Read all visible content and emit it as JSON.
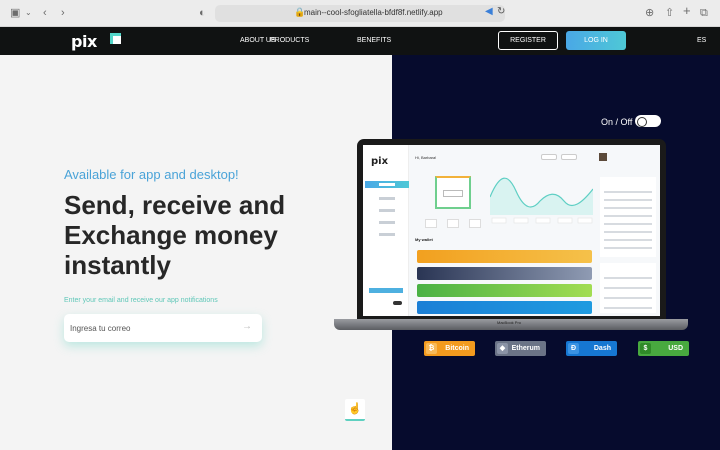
{
  "browser": {
    "url": "main--cool-sfogliatella-bfdf8f.netlify.app"
  },
  "nav": {
    "logo": "pix",
    "links": [
      {
        "label": "ABOUT US"
      },
      {
        "label": "PRODUCTS"
      },
      {
        "label": "BENEFITS"
      }
    ],
    "register_label": "REGISTER",
    "login_label": "LOG IN",
    "language": "ES"
  },
  "hero": {
    "tagline": "Available for app and desktop!",
    "headline": [
      "Send, receive and",
      "Exchange money",
      "instantly"
    ],
    "notify_text": "Enter your email and receive our app notifications",
    "email_placeholder": "Ingresa tu correo",
    "toggle_label": "On / Off"
  },
  "laptop": {
    "brand_label": "MacBook Pro",
    "dashboard_logo": "pix",
    "greeting": "Hi, Barbara!",
    "balance": "$ 12,830.54",
    "wallet_title": "My wallet",
    "panel_movements": "Últimos Movimientos",
    "panel_friends": "Amigos"
  },
  "currencies": [
    {
      "label": "Bitcoin",
      "color": "#f39b1e"
    },
    {
      "label": "Etherum",
      "color": "#6b7487"
    },
    {
      "label": "Dash",
      "color": "#1677d2"
    },
    {
      "label": "USD",
      "color": "#48a93f"
    }
  ],
  "colors": {
    "accent": "#4aa3d8",
    "teal": "#53d6c9",
    "dark_panel": "#060b2d",
    "nav_bg": "#101212"
  }
}
